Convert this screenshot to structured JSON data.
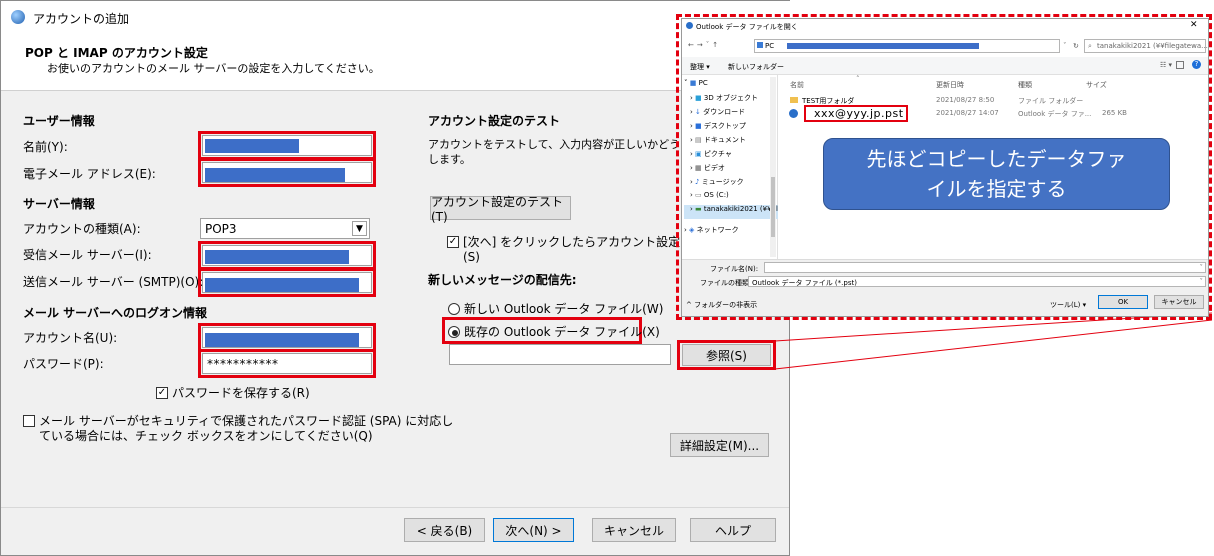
{
  "window": {
    "title": "アカウントの追加"
  },
  "header": {
    "title": "POP と IMAP のアカウント設定",
    "subtitle": "お使いのアカウントのメール サーバーの設定を入力してください。"
  },
  "user_info": {
    "section": "ユーザー情報",
    "name_label": "名前(Y):",
    "email_label": "電子メール アドレス(E):"
  },
  "server_info": {
    "section": "サーバー情報",
    "account_type_label": "アカウントの種類(A):",
    "account_type_value": "POP3",
    "incoming_label": "受信メール サーバー(I):",
    "outgoing_label": "送信メール サーバー (SMTP)(O):"
  },
  "logon_info": {
    "section": "メール サーバーへのログオン情報",
    "account_name_label": "アカウント名(U):",
    "password_label": "パスワード(P):",
    "password_value": "***********",
    "remember_password": "パスワードを保存する(R)",
    "spa_line1": "メール サーバーがセキュリティで保護されたパスワード認証 (SPA) に対応し",
    "spa_line2": "ている場合には、チェック ボックスをオンにしてください(Q)"
  },
  "test": {
    "section": "アカウント設定のテスト",
    "desc_line1": "アカウントをテストして、入力内容が正しいかどうかを確",
    "desc_line2": "します。",
    "test_button": "アカウント設定のテスト(T)",
    "auto_test_line1": "[次へ] をクリックしたらアカウント設定を自動的",
    "auto_test_line2": "(S)"
  },
  "delivery": {
    "section": "新しいメッセージの配信先:",
    "new_file": "新しい Outlook データ ファイル(W)",
    "existing_file": "既存の Outlook データ ファイル(X)",
    "browse_button": "参照(S)"
  },
  "footer": {
    "more_settings": "詳細設定(M)...",
    "back": "< 戻る(B)",
    "next": "次へ(N) >",
    "cancel": "キャンセル",
    "help": "ヘルプ"
  },
  "file_dialog": {
    "title": "Outlook データ ファイルを開く",
    "close": "✕",
    "breadcrumb_root": "PC",
    "search_placeholder": "tanakakiki2021 (¥¥filegatewa...",
    "toolbar_organize": "整理 ▾",
    "toolbar_new_folder": "新しいフォルダー",
    "nav_items": [
      "PC",
      "3D オブジェクト",
      "ダウンロード",
      "デスクトップ",
      "ドキュメント",
      "ピクチャ",
      "ビデオ",
      "ミュージック",
      "OS (C:)",
      "tanakakiki2021 (¥¥fil",
      "ネットワーク"
    ],
    "columns": {
      "name": "名前",
      "date": "更新日時",
      "type": "種類",
      "size": "サイズ"
    },
    "rows": [
      {
        "name": "TEST用フォルダ",
        "date": "2021/08/27 8:50",
        "type": "ファイル フォルダー",
        "size": ""
      },
      {
        "name": "xxx@yyy.jp.pst",
        "date": "2021/08/27 14:07",
        "type": "Outlook データ ファ...",
        "size": "265 KB"
      }
    ],
    "filename_label": "ファイル名(N):",
    "filetype_label": "ファイルの種類(T):",
    "filetype_value": "Outlook データ ファイル (*.pst)",
    "hide_folders": "フォルダーの非表示",
    "tools": "ツール(L) ▾",
    "ok": "OK",
    "cancel": "キャンセル"
  },
  "callout": {
    "line1": "先ほどコピーしたデータファ",
    "line2": "イルを指定する"
  },
  "colors": {
    "highlight_red": "#e3000f",
    "redacted_blue": "#3d6ec8",
    "callout_blue": "#4472c4"
  }
}
